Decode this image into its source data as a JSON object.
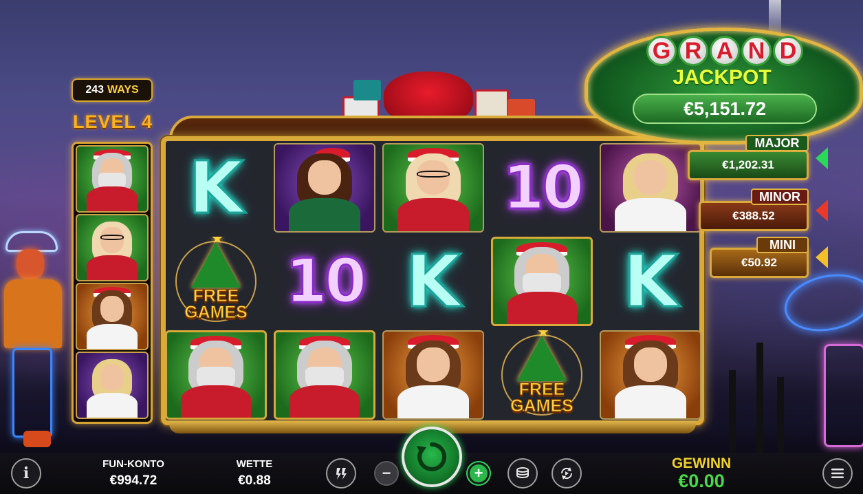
{
  "ways_badge": {
    "count": "243",
    "word": "WAYS"
  },
  "level_label": "LEVEL 4",
  "ladder": [
    "santa",
    "mrs-claus",
    "elf-girl",
    "blonde-girl"
  ],
  "grand": {
    "letters": [
      "G",
      "R",
      "A",
      "N",
      "D"
    ],
    "jackpot_word": "JACKPOT",
    "value": "€5,151.72"
  },
  "major": {
    "tag": "MAJOR",
    "value": "€1,202.31",
    "color": "#2f7a2a",
    "arrow_color": "#2ad85a"
  },
  "minor": {
    "tag": "MINOR",
    "value": "€388.52",
    "color": "#7a2a10",
    "arrow_color": "#e83a2a"
  },
  "mini": {
    "tag": "MINI",
    "value": "€50.92",
    "color": "#8a5a12",
    "arrow_color": "#f2c02a"
  },
  "reels": [
    [
      "K",
      "wild-girl-brunette",
      "mrs-claus",
      "10",
      "blonde-girl"
    ],
    [
      "FREE GAMES",
      "10",
      "K",
      "santa",
      "K"
    ],
    [
      "santa",
      "santa",
      "elf-girl",
      "FREE GAMES",
      "elf-girl"
    ]
  ],
  "free_games_text": {
    "line1": "FREE",
    "line2": "GAMES"
  },
  "bottom_bar": {
    "info_icon": "info-icon",
    "fun_konto_label": "FUN-KONTO",
    "fun_konto_value": "€994.72",
    "wette_label": "WETTE",
    "wette_value": "€0.88",
    "win_label": "GEWINN",
    "win_value": "€0.00",
    "minus_symbol": "−",
    "plus_symbol": "+"
  }
}
